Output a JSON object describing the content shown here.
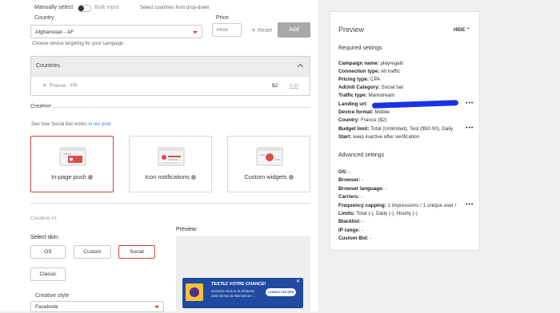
{
  "top": {
    "manual_label": "Manually select",
    "bulk_label": "Bulk input",
    "hint": "Select countries from drop-down"
  },
  "country": {
    "label": "Country",
    "value": "Afghanistan - AF",
    "help": "Choose device targeting for your campaign."
  },
  "price": {
    "label": "Price",
    "placeholder": "Price",
    "reset_label": "Reset",
    "add_label": "Add"
  },
  "countries_panel": {
    "title": "Countries",
    "rows": [
      {
        "name": "France - FR",
        "price": "$2",
        "action": "Edit"
      }
    ]
  },
  "creative": {
    "section_label": "Creative",
    "see_how_prefix": "See how Social Bar works",
    "see_how_link": "in our post",
    "formats": [
      {
        "label": "In-page push"
      },
      {
        "label": "Icon notifications"
      },
      {
        "label": "Custom widgets"
      }
    ],
    "number_label": "Creative #1",
    "select_skin_label": "Select skin:",
    "skins": [
      "OS",
      "Custom",
      "Social",
      "Classic"
    ],
    "style_label": "Creative style",
    "style_value": "Facebook",
    "preview_label": "Preview:"
  },
  "notification": {
    "title": "TESTEZ VOTRE CHANCE!",
    "body": "Inscrivez-vous et et réclamez votre Bonus de Bienvenue !...",
    "cta": "LANCEZ LES DÉS"
  },
  "side": {
    "title": "Preview",
    "hide_label": "HIDE",
    "required_heading": "Required settings",
    "required": [
      {
        "key": "Campaign name:",
        "value": "playregalx"
      },
      {
        "key": "Connection type:",
        "value": "All traffic"
      },
      {
        "key": "Pricing type:",
        "value": "CPA"
      },
      {
        "key": "AdUnit Category:",
        "value": "Social bar"
      },
      {
        "key": "Traffic type:",
        "value": "Mainstream"
      },
      {
        "key": "Landing url:",
        "value": ""
      },
      {
        "key": "Device format:",
        "value": "Mobile"
      },
      {
        "key": "Country:",
        "value": "France ($2)"
      },
      {
        "key": "Budget limit:",
        "value": "Total (Unlimited), Test ($50.00), Daily"
      },
      {
        "key": "Start:",
        "value": "keep inactive after verification"
      }
    ],
    "advanced_heading": "Advanced settings",
    "advanced": [
      {
        "key": "OS:",
        "value": "-"
      },
      {
        "key": "Browser:",
        "value": "-"
      },
      {
        "key": "Browser language:",
        "value": "-"
      },
      {
        "key": "Carriers:",
        "value": "-"
      },
      {
        "key": "Frequency capping:",
        "value": "1 impressions / 1 unique user /"
      },
      {
        "key": "Limits:",
        "value": "Total (-), Daily (-), Hourly (-)"
      },
      {
        "key": "Blacklist:",
        "value": "-"
      },
      {
        "key": "IP range:",
        "value": "-"
      },
      {
        "key": "Custom Bid:",
        "value": "-"
      }
    ]
  },
  "colors": {
    "accent": "#c94646",
    "redaction": "#1a33e6",
    "notification_bg": "#1f4aa0"
  }
}
